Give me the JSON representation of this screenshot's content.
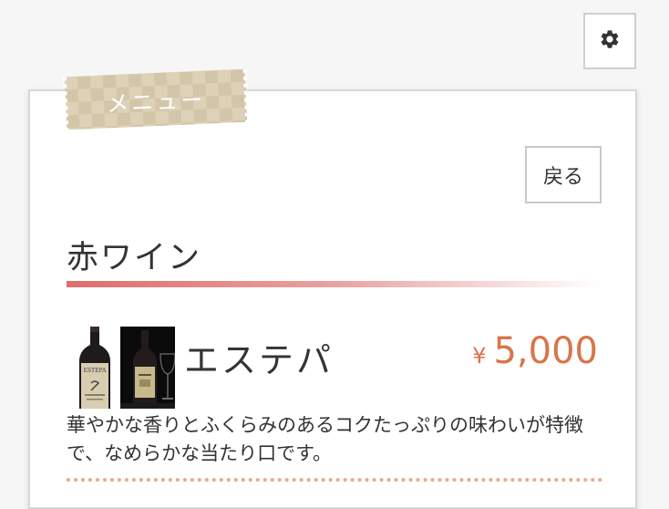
{
  "header": {
    "settings_icon": "gear-icon"
  },
  "menu": {
    "tag_label": "メニュー",
    "back_label": "戻る",
    "section": {
      "title": "赤ワイン",
      "underline_color": "#dd6d6d",
      "items": [
        {
          "name": "エステパ",
          "currency": "¥",
          "price": "5,000",
          "description": "華やかな香りとふくらみのあるコクたっぷりの味わいが特徴で、なめらかな当たり口です。",
          "image_labels": [
            "ESTEPA"
          ]
        }
      ]
    }
  },
  "colors": {
    "accent_price": "#d9744a",
    "tag_bg": "#ddd2b8",
    "divider": "#e9a98f"
  }
}
